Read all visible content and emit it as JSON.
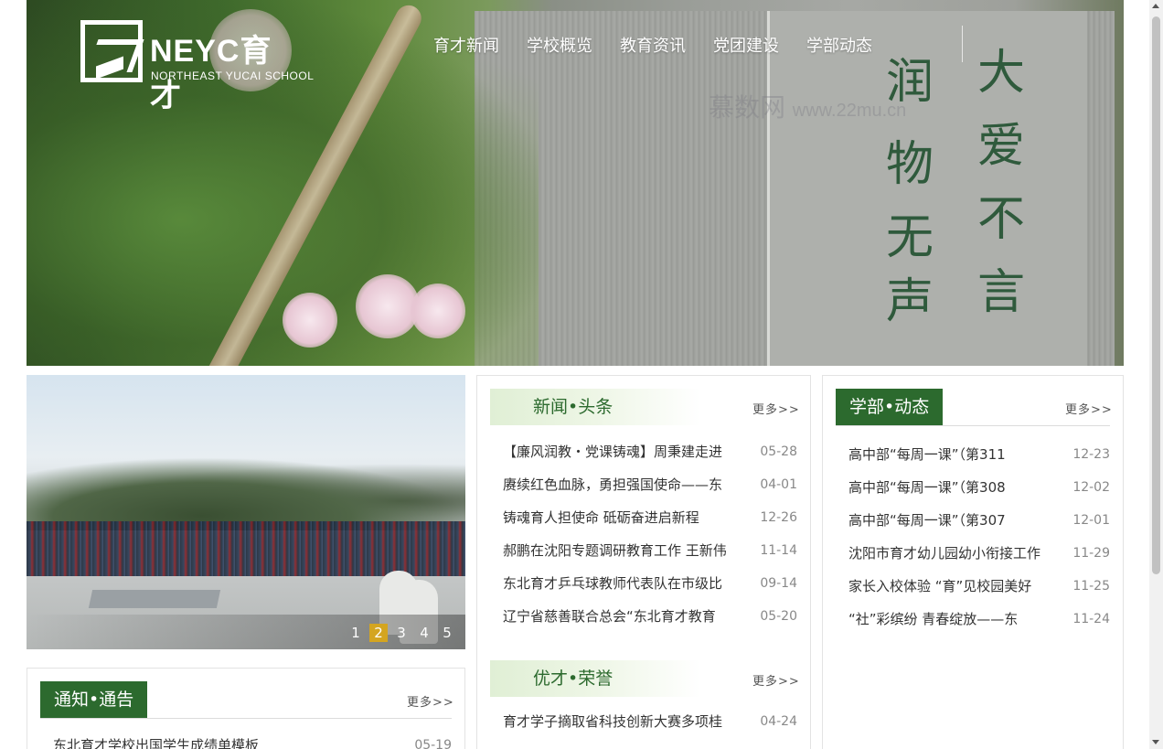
{
  "header": {
    "logo": {
      "name": "NEYC育才",
      "subtitle": "NORTHEAST YUCAI SCHOOL"
    },
    "nav": [
      "育才新闻",
      "学校概览",
      "教育资讯",
      "党团建设",
      "学部动态"
    ],
    "watermark": {
      "brand": "慕数网",
      "url": "www.22mu.cn"
    },
    "inscription": [
      "大",
      "爱",
      "不",
      "言",
      "润",
      "物",
      "无",
      "声"
    ]
  },
  "slider": {
    "pages": [
      "1",
      "2",
      "3",
      "4",
      "5"
    ],
    "active_page": "2"
  },
  "news_headlines": {
    "title": "新闻•头条",
    "more": "更多>>",
    "items": [
      {
        "title": "【廉风润教・党课铸魂】周秉建走进",
        "date": "05-28"
      },
      {
        "title": "赓续红色血脉，勇担强国使命——东",
        "date": "04-01"
      },
      {
        "title": "铸魂育人担使命 砥砺奋进启新程",
        "date": "12-26"
      },
      {
        "title": "郝鹏在沈阳专题调研教育工作 王新伟",
        "date": "11-14"
      },
      {
        "title": "东北育才乒乓球教师代表队在市级比",
        "date": "09-14"
      },
      {
        "title": "辽宁省慈善联合总会“东北育才教育",
        "date": "05-20"
      }
    ]
  },
  "honors": {
    "title": "优才•荣誉",
    "more": "更多>>",
    "items": [
      {
        "title": "育才学子摘取省科技创新大赛多项桂",
        "date": "04-24"
      }
    ]
  },
  "department_news": {
    "title": "学部•动态",
    "more": "更多>>",
    "items": [
      {
        "title": "高中部“每周一课”（第311",
        "date": "12-23"
      },
      {
        "title": "高中部“每周一课”（第308",
        "date": "12-02"
      },
      {
        "title": "高中部“每周一课”（第307",
        "date": "12-01"
      },
      {
        "title": "沈阳市育才幼儿园幼小衔接工作",
        "date": "11-29"
      },
      {
        "title": "家长入校体验 “育”见校园美好",
        "date": "11-25"
      },
      {
        "title": "“社”彩缤纷 青春绽放——东",
        "date": "11-24"
      }
    ]
  },
  "notices": {
    "title": "通知•通告",
    "more": "更多>>",
    "items": [
      {
        "title": "东北育才学校出国学生成绩单模板",
        "date": "05-19"
      }
    ]
  },
  "colors": {
    "brand_green": "#2c6a2e",
    "active_dot": "#d4a520"
  }
}
